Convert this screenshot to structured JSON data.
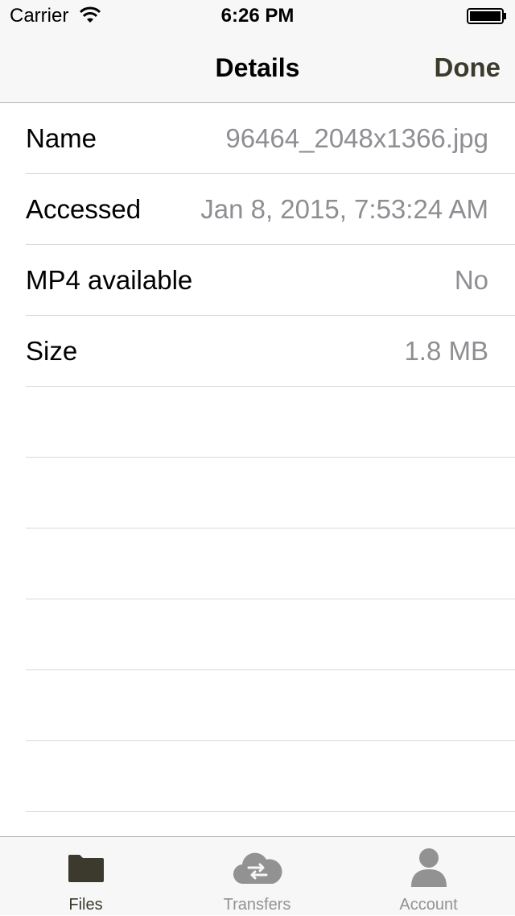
{
  "status_bar": {
    "carrier": "Carrier",
    "time": "6:26 PM"
  },
  "nav": {
    "title": "Details",
    "done_label": "Done"
  },
  "details": [
    {
      "label": "Name",
      "value": "96464_2048x1366.jpg"
    },
    {
      "label": "Accessed",
      "value": "Jan 8, 2015, 7:53:24 AM"
    },
    {
      "label": "MP4 available",
      "value": "No"
    },
    {
      "label": "Size",
      "value": "1.8 MB"
    }
  ],
  "tabs": [
    {
      "label": "Files",
      "icon": "folder-icon",
      "active": true
    },
    {
      "label": "Transfers",
      "icon": "cloud-transfer-icon",
      "active": false
    },
    {
      "label": "Account",
      "icon": "person-icon",
      "active": false
    }
  ],
  "colors": {
    "accent": "#3b3a2c",
    "inactive": "#929292",
    "value_text": "#8e8e93",
    "bar_background": "#f7f7f7"
  }
}
